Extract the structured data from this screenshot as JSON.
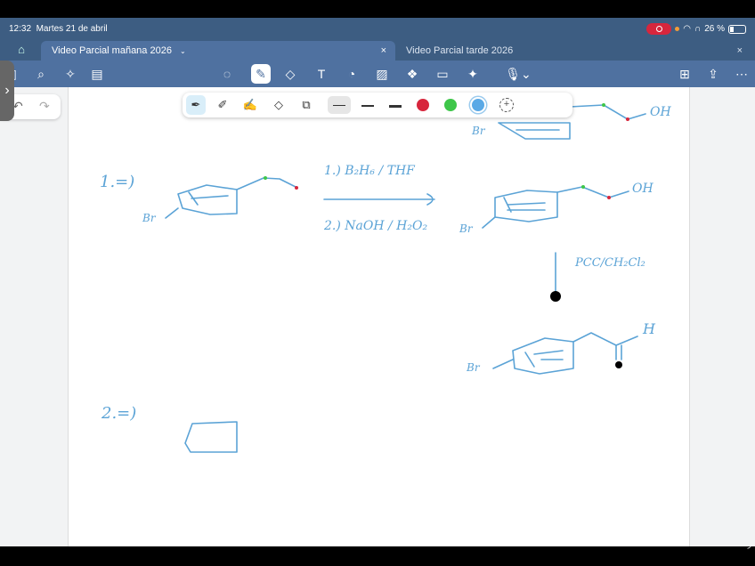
{
  "status_bar": {
    "time": "12:32",
    "date": "Martes 21 de abril",
    "battery_text": "26 %"
  },
  "tabs": [
    {
      "label": "Video Parcial mañana 2026",
      "active": true
    },
    {
      "label": "Video Parcial tarde 2026",
      "active": false
    }
  ],
  "toolbar": {
    "left_icons": [
      "sidebar-icon",
      "search-icon",
      "sparkle-icon",
      "outline-icon"
    ],
    "center_icons": [
      "lasso-icon",
      "pen-icon",
      "eraser-icon",
      "textbox-icon",
      "shapes-icon",
      "image-icon",
      "elements-icon",
      "sticky-note-icon",
      "laser-pointer-icon",
      "microphone-icon"
    ],
    "right_icons": [
      "add-page-icon",
      "share-icon",
      "more-icon"
    ]
  },
  "pen_tray": {
    "colors": [
      "#d7263d",
      "#3ec64a",
      "#5aa9e6"
    ],
    "selected_color": "#5aa9e6"
  },
  "notes": {
    "exercise1_label": "1.=)",
    "exercise2_label": "2.=)",
    "reagent_step1": "1.) B₂H₆ / THF",
    "reagent_step2": "2.) NaOH / H₂O₂",
    "pcc_label": "PCC/CH₂Cl₂",
    "oh_label": "OH",
    "br_label": "Br",
    "h_label": "H"
  }
}
